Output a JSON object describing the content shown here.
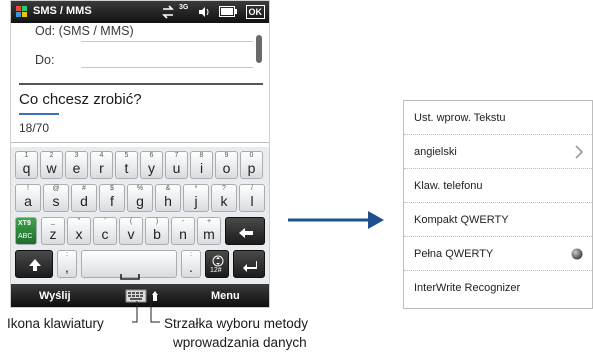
{
  "phone": {
    "status_title": "SMS / MMS",
    "status_network": "3G",
    "status_ok": "OK",
    "from_label": "Od:",
    "from_value": "(SMS / MMS)",
    "to_label": "Do:",
    "compose_prompt": "Co chcesz zrobić?",
    "char_counter": "18/70",
    "keyboard": {
      "row1": [
        {
          "c": "q",
          "s": "1"
        },
        {
          "c": "w",
          "s": "2"
        },
        {
          "c": "e",
          "s": "3"
        },
        {
          "c": "r",
          "s": "4"
        },
        {
          "c": "t",
          "s": "5"
        },
        {
          "c": "y",
          "s": "6"
        },
        {
          "c": "u",
          "s": "7"
        },
        {
          "c": "i",
          "s": "8"
        },
        {
          "c": "o",
          "s": "9"
        },
        {
          "c": "p",
          "s": "0"
        }
      ],
      "row2": [
        {
          "c": "a",
          "s": "!"
        },
        {
          "c": "s",
          "s": "@"
        },
        {
          "c": "d",
          "s": "#"
        },
        {
          "c": "f",
          "s": "$"
        },
        {
          "c": "g",
          "s": "%"
        },
        {
          "c": "h",
          "s": "&"
        },
        {
          "c": "j",
          "s": "*"
        },
        {
          "c": "k",
          "s": "?"
        },
        {
          "c": "l",
          "s": "/"
        }
      ],
      "row3": [
        {
          "c": "z",
          "s": "_"
        },
        {
          "c": "x",
          "s": "\""
        },
        {
          "c": "c",
          "s": "'"
        },
        {
          "c": "v",
          "s": "("
        },
        {
          "c": "b",
          "s": ")"
        },
        {
          "c": "n",
          "s": "-"
        },
        {
          "c": "m",
          "s": "+"
        }
      ],
      "xt9_top": "XT9",
      "xt9_bottom": "ABC",
      "comma_sup": ":",
      "comma_key": ",",
      "period_sup": ":",
      "period_key": ".",
      "num_label": "12#"
    },
    "softkey_left": "Wyślij",
    "softkey_right": "Menu"
  },
  "callouts": {
    "keyboard_icon": "Ikona klawiatury",
    "arrow_line1": "Strzałka wyboru metody",
    "arrow_line2": "wprowadzania danych"
  },
  "menu": {
    "items": [
      {
        "label": "Ust. wprow. Tekstu"
      },
      {
        "label": "angielski"
      },
      {
        "label": "Klaw. telefonu"
      },
      {
        "label": "Kompakt QWERTY"
      },
      {
        "label": "Pełna QWERTY"
      },
      {
        "label": "InterWrite Recognizer"
      }
    ]
  },
  "colors": {
    "arrow": "#1f4f8f",
    "status_bar": "#1a1a1a",
    "accent_blue": "#3a6fc4"
  }
}
